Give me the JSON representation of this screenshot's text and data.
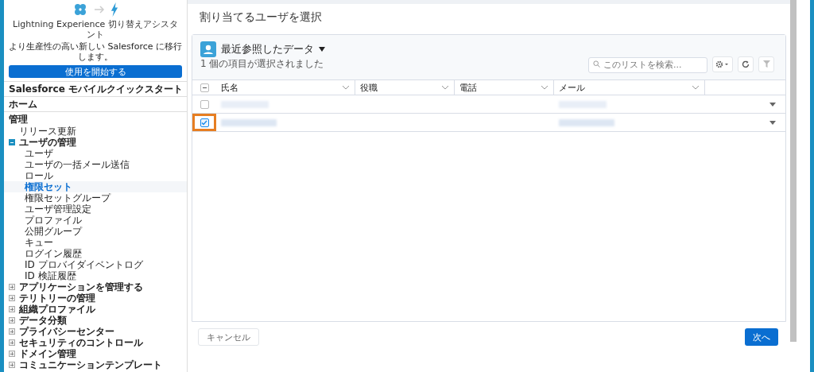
{
  "sidebar": {
    "promo": {
      "title": "Lightning Experience 切り替えアシスタント",
      "description": "より生産性の高い新しい Salesforce に移行します。",
      "button": "使用を開始する"
    },
    "links": [
      "Salesforce モバイルクイックスタート",
      "ホーム"
    ],
    "section": "管理",
    "tree": [
      {
        "label": "リリース更新",
        "selected": false
      },
      {
        "label": "ユーザの管理",
        "selected": false,
        "expanded": true,
        "children": [
          {
            "label": "ユーザ",
            "selected": false
          },
          {
            "label": "ユーザの一括メール送信",
            "selected": false
          },
          {
            "label": "ロール",
            "selected": false
          },
          {
            "label": "権限セット",
            "selected": true
          },
          {
            "label": "権限セットグループ",
            "selected": false
          },
          {
            "label": "ユーザ管理設定",
            "selected": false
          },
          {
            "label": "プロファイル",
            "selected": false
          },
          {
            "label": "公開グループ",
            "selected": false
          },
          {
            "label": "キュー",
            "selected": false
          },
          {
            "label": "ログイン履歴",
            "selected": false
          },
          {
            "label": "ID プロバイダイベントログ",
            "selected": false
          },
          {
            "label": "ID 検証履歴",
            "selected": false
          }
        ]
      },
      {
        "label": "アプリケーションを管理する",
        "selected": false,
        "expanded": false
      },
      {
        "label": "テリトリーの管理",
        "selected": false,
        "expanded": false
      },
      {
        "label": "組織プロファイル",
        "selected": false,
        "expanded": false
      },
      {
        "label": "データ分類",
        "selected": false,
        "expanded": false
      },
      {
        "label": "プライバシーセンター",
        "selected": false,
        "expanded": false
      },
      {
        "label": "セキュリティのコントロール",
        "selected": false,
        "expanded": false
      },
      {
        "label": "ドメイン管理",
        "selected": false,
        "expanded": false
      },
      {
        "label": "コミュニケーションテンプレート",
        "selected": false,
        "expanded": false
      }
    ]
  },
  "dialog": {
    "title": "割り当てるユーザを選択",
    "list": {
      "name": "最近参照したデータ",
      "status": "1 個の項目が選択されました",
      "search": {
        "placeholder": "このリストを検索..."
      },
      "columns": [
        "氏名",
        "役職",
        "電話",
        "メール"
      ],
      "select_all": {
        "indeterminate": true
      },
      "rows": [
        {
          "selected": false,
          "highlighted": false
        },
        {
          "selected": true,
          "highlighted": true
        }
      ]
    },
    "buttons": {
      "cancel": "キャンセル",
      "next": "次へ"
    }
  }
}
